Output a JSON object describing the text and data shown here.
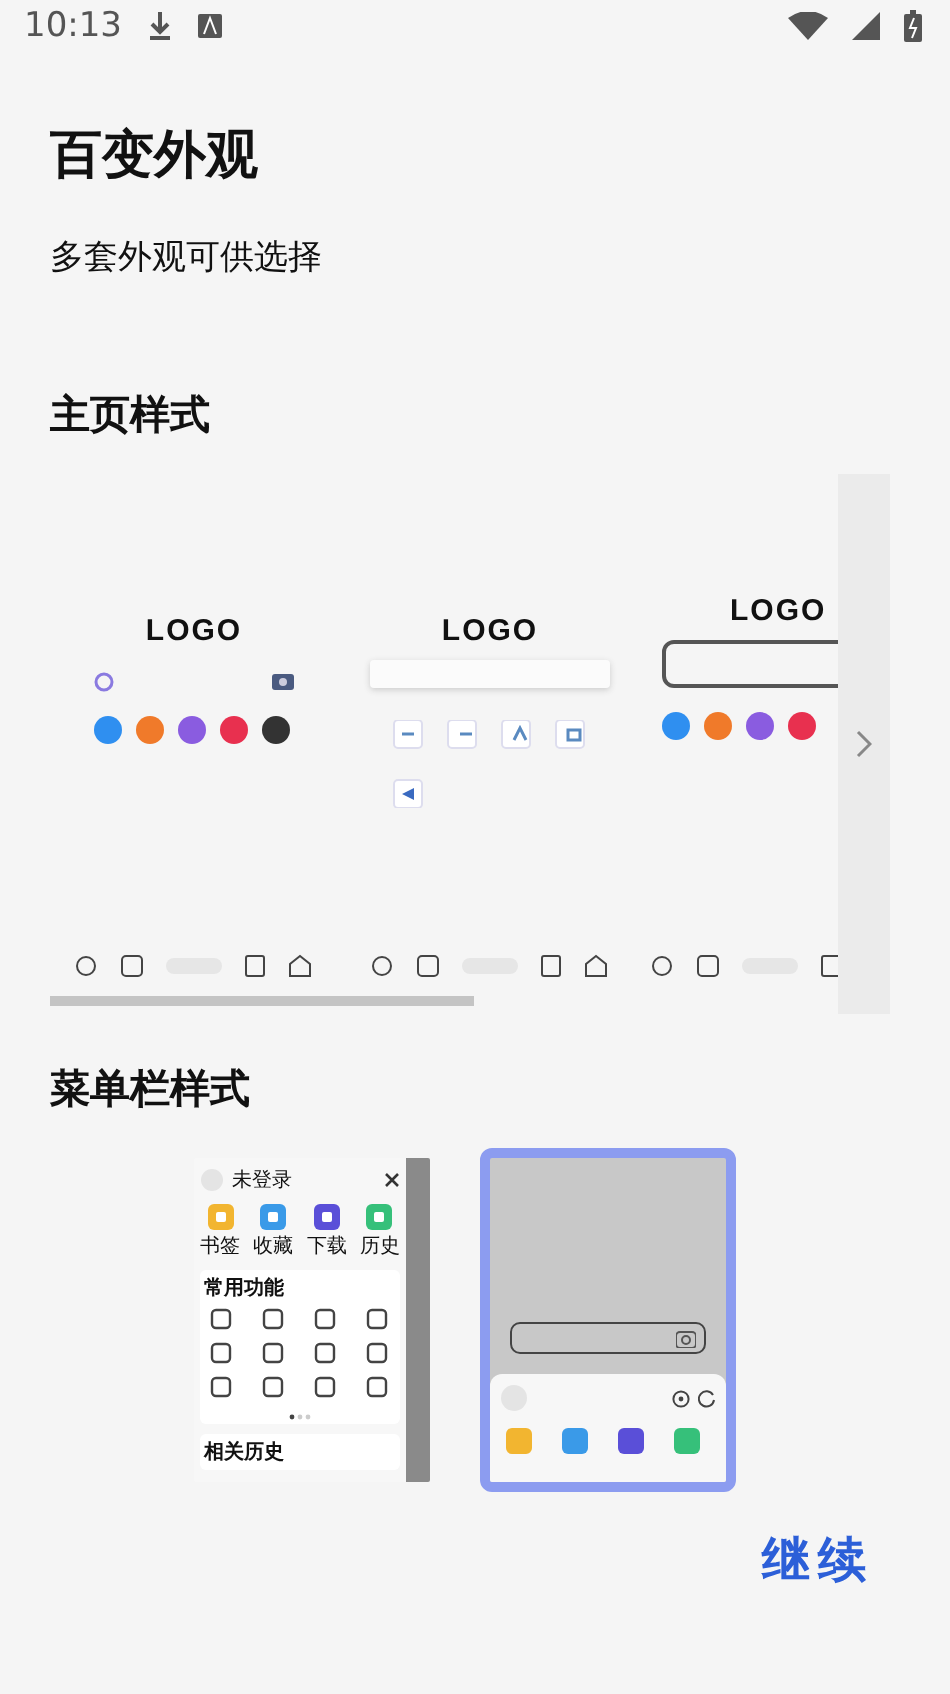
{
  "status_bar": {
    "time": "10:13"
  },
  "title": "百变外观",
  "subtitle": "多套外观可供选择",
  "home_styles": {
    "heading": "主页样式",
    "styles": [
      {
        "kind": "icon-row",
        "logo": "LOGO"
      },
      {
        "kind": "search-grid",
        "logo": "LOGO"
      },
      {
        "kind": "outlined-search",
        "logo": "LOGO"
      }
    ]
  },
  "menu_styles": {
    "heading": "菜单栏样式",
    "styles": [
      {
        "kind": "drawer",
        "selected": false,
        "user": "未登录",
        "shortcuts": [
          "书签",
          "收藏",
          "下载",
          "历史"
        ],
        "section": "常用功能",
        "footer": "相关历史"
      },
      {
        "kind": "bottom-sheet",
        "selected": true
      }
    ]
  },
  "continue_button": "继续"
}
